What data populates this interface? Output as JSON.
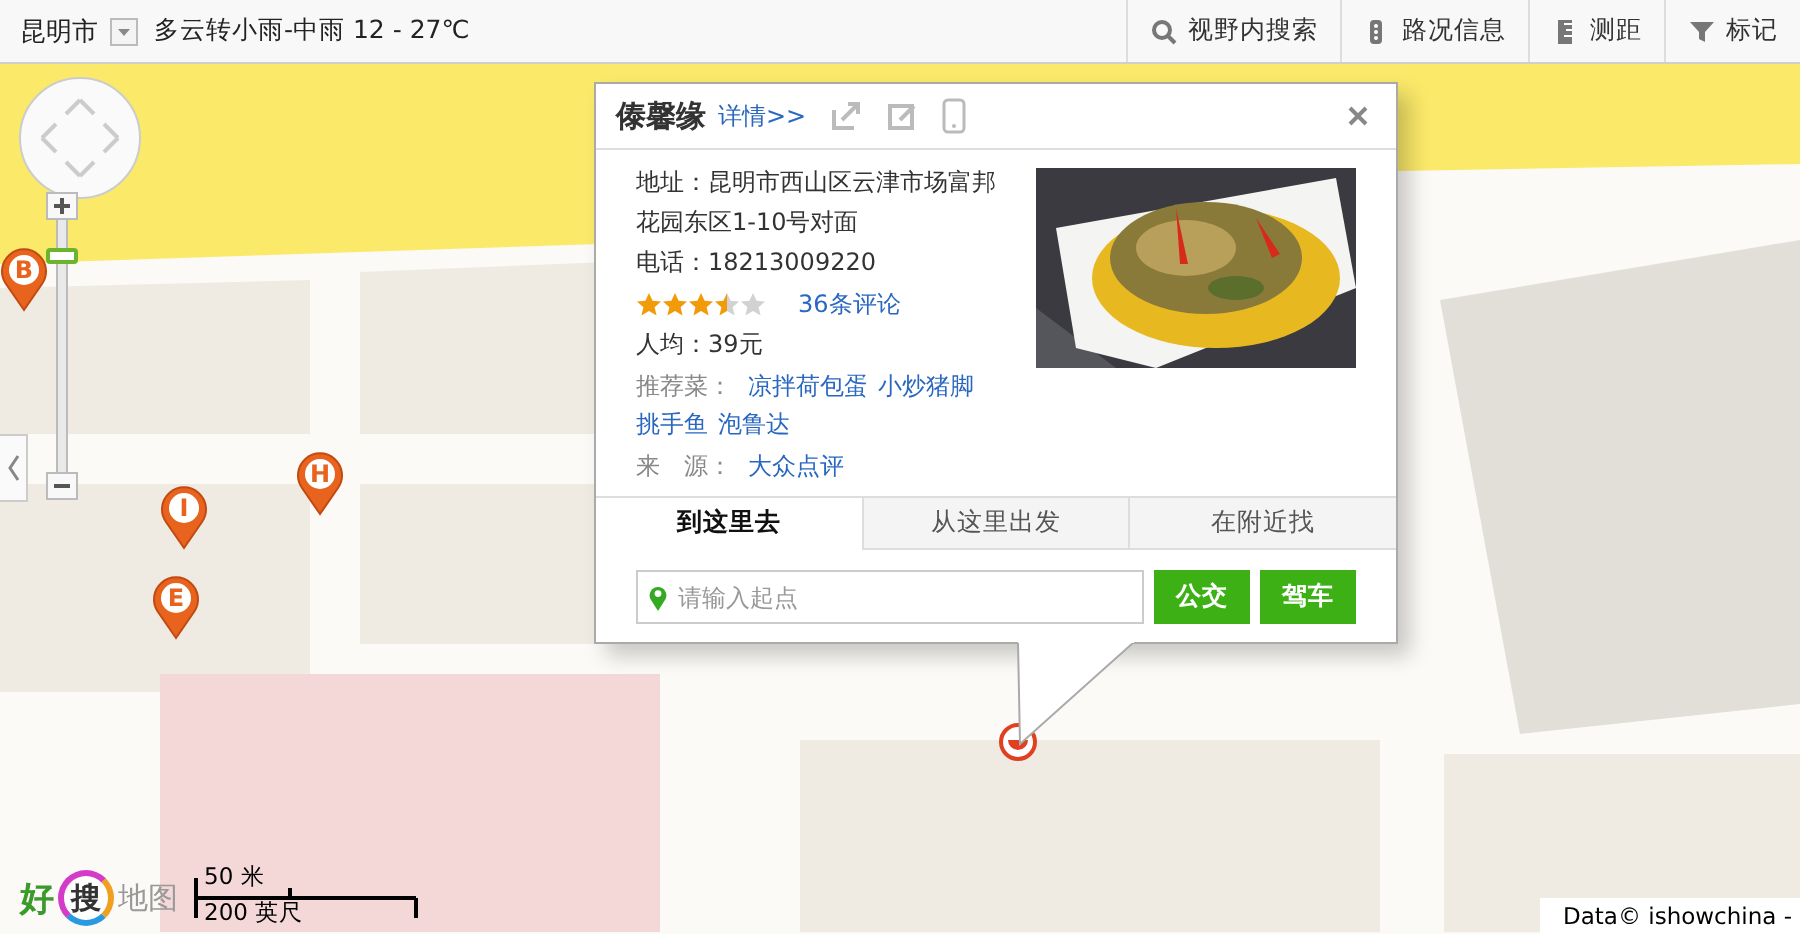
{
  "top_bar": {
    "city": "昆明市",
    "weather": "多云转小雨-中雨 12 - 27℃",
    "tools": [
      {
        "kind": "search",
        "label": "视野内搜索"
      },
      {
        "kind": "traffic",
        "label": "路况信息"
      },
      {
        "kind": "ruler",
        "label": "测距"
      },
      {
        "kind": "mark",
        "label": "标记"
      }
    ]
  },
  "map": {
    "kind": "picture"
  },
  "zoom": {
    "level": 0.88
  },
  "markers": [
    {
      "label": "B"
    },
    {
      "label": "I"
    },
    {
      "label": "H"
    },
    {
      "label": "E"
    }
  ],
  "popup": {
    "title": "傣馨缘",
    "details_link": "详情>>",
    "address": "地址：昆明市西山区云津市场富邦花园东区1-10号对面",
    "phone": "电话：18213009220",
    "stars": 3.5,
    "reviews_link": "36条评论",
    "price": "人均：39元",
    "recommended_label": "推荐菜：",
    "dishes": [
      "凉拌荷包蛋",
      "小炒猪脚",
      "挑手鱼",
      "泡鲁达"
    ],
    "source_label": "来　源：",
    "source_link": "大众点评",
    "photo": {
      "kind": "picture"
    },
    "tabs": [
      {
        "label": "到这里去",
        "selected": true
      },
      {
        "label": "从这里出发",
        "selected": false
      },
      {
        "label": "在附近找",
        "selected": false
      }
    ],
    "start_field": {
      "placeholder": "请输入起点"
    },
    "buttons": [
      "公交",
      "驾车"
    ]
  },
  "logo": {
    "part_1": "好",
    "part_2": "搜",
    "part_3": "地图"
  },
  "scale": {
    "metric": "50 米",
    "imperial": "200 英尺"
  },
  "copyright": "Data© ishowchina -"
}
